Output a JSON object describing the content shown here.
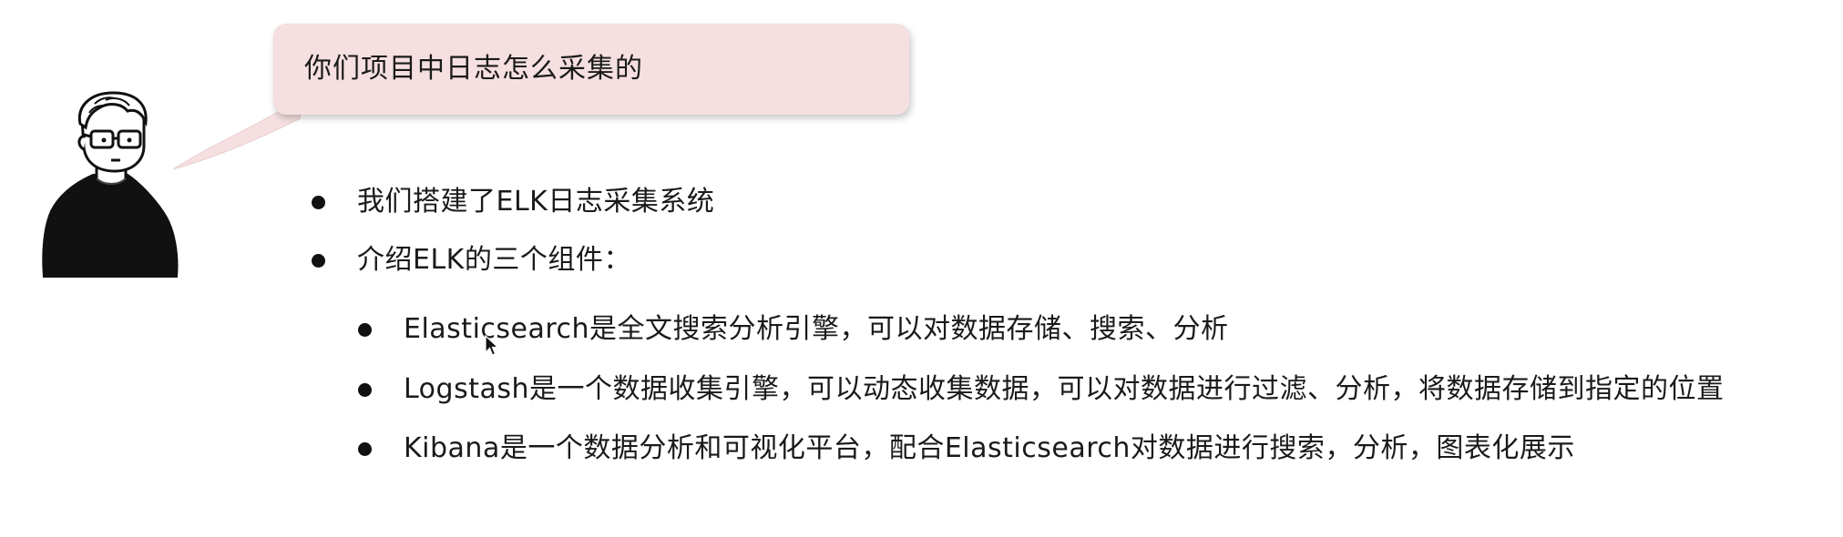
{
  "question": {
    "text": "你们项目中日志怎么采集的"
  },
  "answers": [
    {
      "text": "我们搭建了ELK日志采集系统"
    },
    {
      "text": "介绍ELK的三个组件："
    }
  ],
  "components": [
    {
      "text": "Elasticsearch是全文搜索分析引擎，可以对数据存储、搜索、分析"
    },
    {
      "text": "Logstash是一个数据收集引擎，可以动态收集数据，可以对数据进行过滤、分析，将数据存储到指定的位置"
    },
    {
      "text": "Kibana是一个数据分析和可视化平台，配合Elasticsearch对数据进行搜索，分析，图表化展示"
    }
  ],
  "colors": {
    "bubble": "#f5dfe0",
    "text": "#1a1a1a",
    "bullet": "#111111"
  },
  "icons": {
    "avatar": "man-with-glasses-avatar",
    "cursor": "mouse-pointer-icon"
  }
}
